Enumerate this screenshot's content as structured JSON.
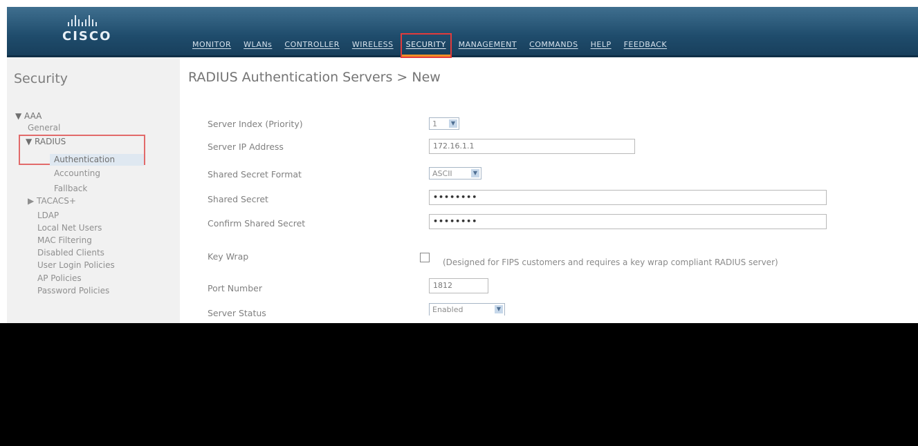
{
  "brand": {
    "logo_text": "CISCO"
  },
  "menu": [
    {
      "label": "MONITOR",
      "active": false
    },
    {
      "label": "WLANs",
      "active": false
    },
    {
      "label": "CONTROLLER",
      "active": false
    },
    {
      "label": "WIRELESS",
      "active": false
    },
    {
      "label": "SECURITY",
      "active": true
    },
    {
      "label": "MANAGEMENT",
      "active": false
    },
    {
      "label": "COMMANDS",
      "active": false
    },
    {
      "label": "HELP",
      "active": false
    },
    {
      "label": "FEEDBACK",
      "active": false
    }
  ],
  "sidebar": {
    "title": "Security",
    "items": [
      {
        "label": "▼ AAA"
      },
      {
        "label": "General"
      },
      {
        "label": "▼ RADIUS"
      },
      {
        "label": "Authentication"
      },
      {
        "label": "Accounting"
      },
      {
        "label": "Fallback"
      },
      {
        "label": "▶ TACACS+"
      },
      {
        "label": "LDAP"
      },
      {
        "label": "Local Net Users"
      },
      {
        "label": "MAC Filtering"
      },
      {
        "label": "Disabled Clients"
      },
      {
        "label": "User Login Policies"
      },
      {
        "label": "AP Policies"
      },
      {
        "label": "Password Policies"
      }
    ]
  },
  "main": {
    "title": "RADIUS Authentication Servers > New",
    "form": {
      "server_index_label": "Server Index (Priority)",
      "server_index_value": "1",
      "server_ip_label": "Server IP Address",
      "server_ip_value": "172.16.1.1",
      "secret_format_label": "Shared Secret Format",
      "secret_format_value": "ASCII",
      "shared_secret_label": "Shared Secret",
      "shared_secret_value": "••••••••",
      "confirm_secret_label": "Confirm Shared Secret",
      "confirm_secret_value": "••••••••",
      "key_wrap_label": "Key Wrap",
      "key_wrap_checked": false,
      "key_wrap_note": "(Designed for FIPS customers and requires a key wrap compliant RADIUS server)",
      "port_label": "Port Number",
      "port_value": "1812",
      "status_label": "Server Status",
      "status_value": "Enabled"
    }
  },
  "colors": {
    "topbar": "#1f4c6c",
    "highlight": "#e23b3b",
    "active_underline": "#f19026"
  }
}
